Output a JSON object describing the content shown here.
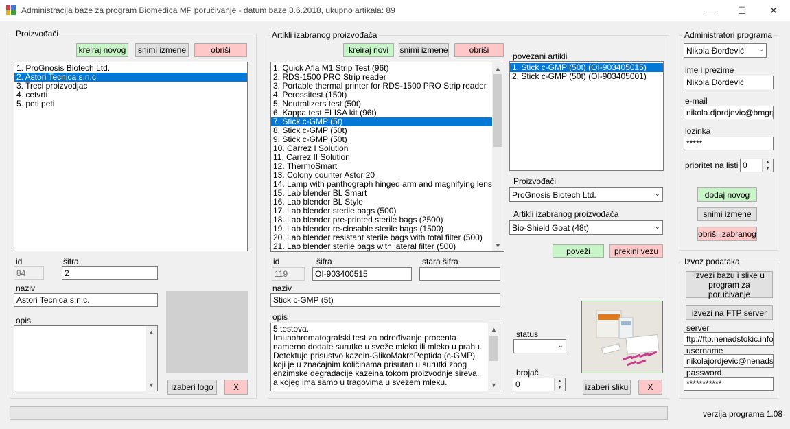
{
  "window": {
    "title": "Administracija baze za program Biomedica MP poručivanje - datum baze 8.6.2018, ukupno artikala: 89",
    "minimize": "—",
    "maximize": "☐",
    "close": "✕"
  },
  "proizvodjaci": {
    "title": "Proizvođači",
    "btn_create": "kreiraj novog",
    "btn_save": "snimi izmene",
    "btn_delete": "obriši",
    "items": [
      "1. ProGnosis Biotech Ltd.",
      "2. Astori Tecnica s.n.c.",
      "3. Treci proizvodjac",
      "4. cetvrti",
      "5. peti peti"
    ],
    "selected_index": 1,
    "id_label": "id",
    "id_value": "84",
    "sifra_label": "šifra",
    "sifra_value": "2",
    "naziv_label": "naziv",
    "naziv_value": "Astori Tecnica s.n.c.",
    "opis_label": "opis",
    "opis_value": "",
    "btn_logo": "izaberi logo",
    "btn_x": "X"
  },
  "artikli": {
    "title": "Artikli izabranog proizvođača",
    "btn_create": "kreiraj novi",
    "btn_save": "snimi izmene",
    "btn_delete": "obriši",
    "items": [
      "1. Quick Afla M1 Strip Test (96t)",
      "2. RDS-1500 PRO Strip reader",
      "3. Portable thermal printer for RDS-1500 PRO Strip reader",
      "4. Perossitest (150t)",
      "5. Neutralizers test (50t)",
      "6. Kappa test ELISA kit (96t)",
      "7. Stick c-GMP (5t)",
      "8. Stick c-GMP (50t)",
      "9. Stick c-GMP (50t)",
      "10. Carrez I Solution",
      "11. Carrez II Solution",
      "12. ThermoSmart",
      "13. Colony counter Astor 20",
      "14. Lamp with panthograph hinged arm and magnifying lens",
      "15. Lab blender BL Smart",
      "16. Lab blender BL Style",
      "17. Lab blender sterile bags (500)",
      "18. Lab blender pre-printed sterile bags (2500)",
      "19. Lab blender re-closable sterile bags (1500)",
      "20. Lab blender resistant sterile bags with total filter (500)",
      "21. Lab blender sterile bags with lateral filter (500)"
    ],
    "selected_index": 6,
    "id_label": "id",
    "id_value": "119",
    "sifra_label": "šifra",
    "sifra_value": "OI-903400515",
    "stara_sifra_label": "stara šifra",
    "stara_sifra_value": "",
    "naziv_label": "naziv",
    "naziv_value": "Stick c-GMP (5t)",
    "opis_label": "opis",
    "opis_value": "5 testova.\nImunohromatografski test za određivanje procenta namerno dodate surutke u sveže mleko ili mleko u prahu.\nDetektuje prisustvo kazein-GlikoMakroPeptida (c-GMP) koji je u značajnim količinama prisutan u surutki zbog enzimske degradacije kazeina tokom proizvodnje sireva, a kojeg ima samo u tragovima u svežem mleku.",
    "povezani_label": "povezani artikli",
    "povezani_items": [
      "1. Stick c-GMP (50t) (OI-903405015)",
      "2. Stick c-GMP (50t) (OI-903405001)"
    ],
    "povezani_selected_index": 0,
    "proizv_label": "Proizvođači",
    "proizv_value": "ProGnosis Biotech Ltd.",
    "artikli_combo_label": "Artikli izabranog proizvođača",
    "artikli_combo_value": "Bio-Shield Goat (48t)",
    "btn_povezi": "poveži",
    "btn_prekini": "prekini vezu",
    "status_label": "status",
    "status_value": "",
    "brojac_label": "brojač",
    "brojac_value": "0",
    "btn_slika": "izaberi sliku",
    "btn_x": "X"
  },
  "admini": {
    "title": "Administratori programa",
    "selected": "Nikola Đorđević",
    "ime_label": "ime i prezime",
    "ime_value": "Nikola Đorđević",
    "email_label": "e-mail",
    "email_value": "nikola.djordjevic@bmgrp.rs",
    "lozinka_label": "lozinka",
    "lozinka_value": "*****",
    "prioritet_label": "prioritet na listi",
    "prioritet_value": "0",
    "btn_add": "dodaj novog",
    "btn_save": "snimi izmene",
    "btn_delete": "obriši izabranog"
  },
  "izvoz": {
    "title": "Izvoz podataka",
    "btn_export": "izvezi bazu i slike u program za poručivanje",
    "btn_ftp": "izvezi na FTP server",
    "server_label": "server",
    "server_value": "ftp://ftp.nenadstokic.info/",
    "username_label": "username",
    "username_value": "nikolajordjevic@nenadstokic",
    "password_label": "password",
    "password_value": "***********"
  },
  "footer": {
    "version": "verzija programa 1.08"
  }
}
